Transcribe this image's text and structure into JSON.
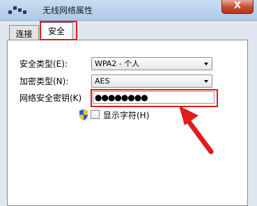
{
  "window": {
    "title": "无线网络属性",
    "close_label": "X"
  },
  "tabs": [
    {
      "label": "连接"
    },
    {
      "label": "安全"
    }
  ],
  "security": {
    "type_label": "安全类型(E):",
    "type_value": "WPA2 - 个人",
    "encryption_label": "加密类型(N):",
    "encryption_value": "AES",
    "key_label": "网络安全密钥(K)",
    "key_value": "●●●●●●●●",
    "show_chars_label": "显示字符(H)"
  },
  "colors": {
    "annotation_red": "#e01c1c"
  },
  "icons": {
    "shield": "uac-shield-icon",
    "annotation": "red-arrow-icon"
  }
}
